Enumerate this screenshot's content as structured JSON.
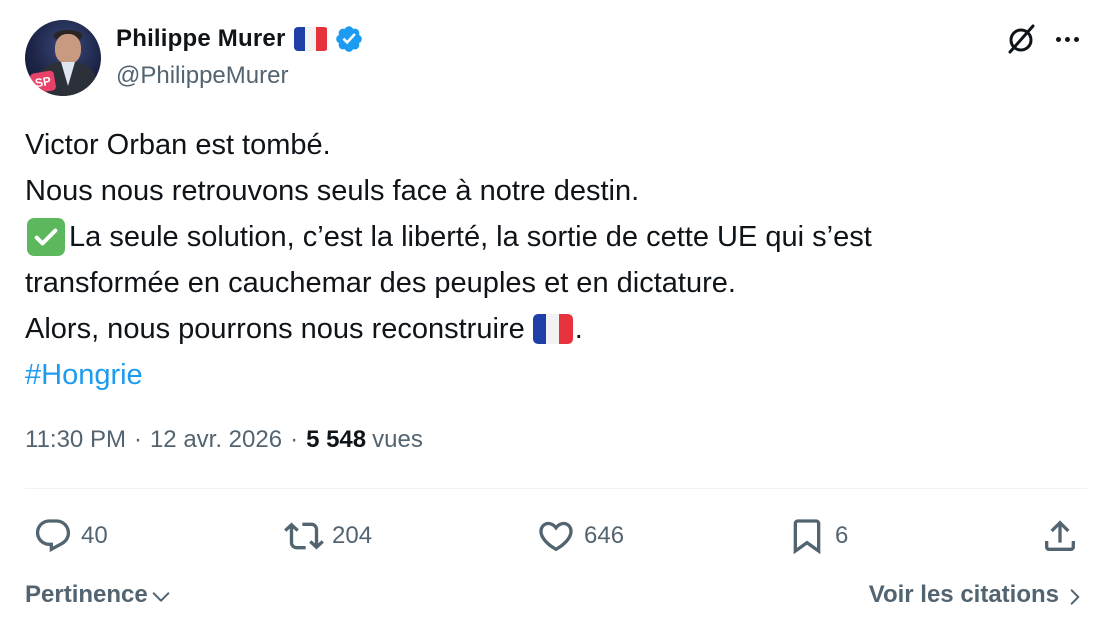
{
  "author": {
    "display_name": "Philippe Murer",
    "handle": "@PhilippeMurer",
    "name_flag": "french-flag-emoji",
    "verified": true,
    "avatar_logo_text": "SP"
  },
  "tweet": {
    "lines": [
      "Victor Orban est tombé.",
      "Nous nous retrouvons seuls face à notre destin.",
      "La seule solution, c’est la liberté, la sortie de cette UE qui s’est",
      "transformée en cauchemar des peuples et en dictature.",
      "Alors, nous pourrons nous reconstruire",
      "."
    ],
    "hashtag": "#Hongrie"
  },
  "meta": {
    "time": "11:30 PM",
    "separator": "·",
    "date": "12 avr. 2026",
    "views_count": "5 548",
    "views_label": "vues"
  },
  "actions": {
    "replies": "40",
    "reposts": "204",
    "likes": "646",
    "bookmarks": "6"
  },
  "footer": {
    "sort_label": "Pertinence",
    "quotes_label": "Voir les citations"
  },
  "colors": {
    "text": "#0f1419",
    "secondary": "#536471",
    "link": "#1d9bf0",
    "verified": "#1d9bf0",
    "check_emoji": "#5cb85c"
  }
}
